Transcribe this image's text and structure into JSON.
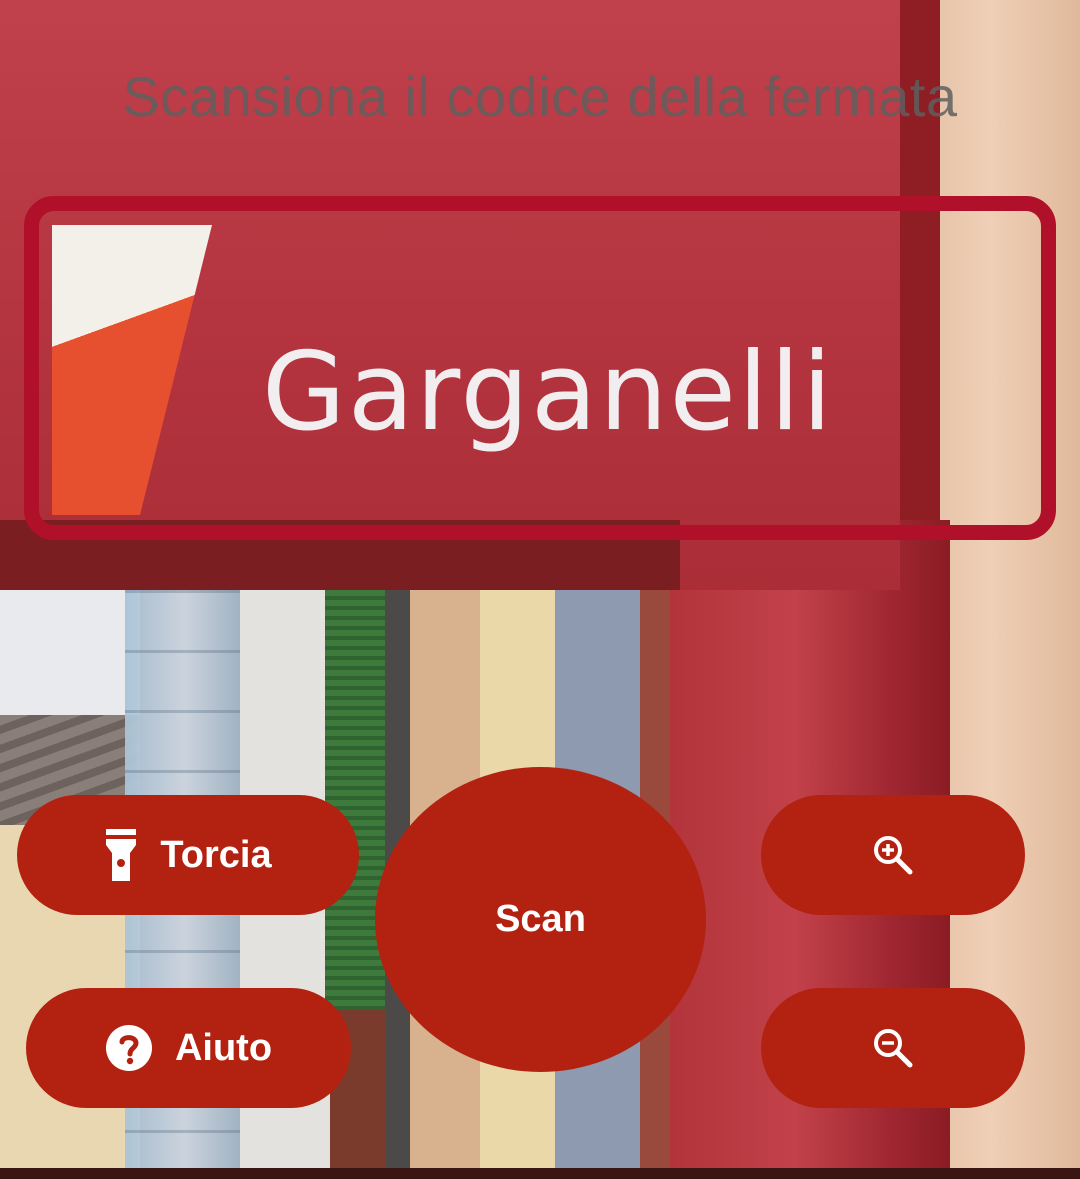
{
  "scanner": {
    "title": "Scansiona il codice della fermata"
  },
  "camera_view": {
    "sign_text": "Garganelli"
  },
  "buttons": {
    "torch_label": "Torcia",
    "help_label": "Aiuto",
    "scan_label": "Scan",
    "zoom_in_icon": "zoom-in-icon",
    "zoom_out_icon": "zoom-out-icon",
    "torch_icon": "flashlight-icon",
    "help_icon": "help-circle-icon"
  },
  "colors": {
    "button_bg": "#b32210",
    "frame": "#b0102a",
    "title_text": "#5f5f5f"
  }
}
